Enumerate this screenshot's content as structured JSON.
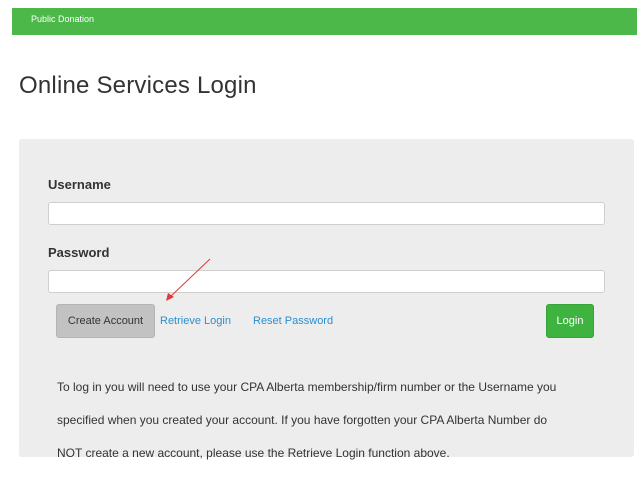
{
  "topbar": {
    "link_label": "Public Donation",
    "color": "#4cb84a"
  },
  "page": {
    "title": "Online Services Login"
  },
  "form": {
    "username_label": "Username",
    "username_value": "",
    "password_label": "Password",
    "password_value": "",
    "create_account_label": "Create Account",
    "retrieve_login_label": "Retrieve Login",
    "reset_password_label": "Reset Password",
    "login_label": "Login"
  },
  "help_text": {
    "lines": [
      "To log in you will need to use your CPA Alberta membership/firm number or the Username you",
      "specified when you created your account. If you have forgotten your CPA Alberta Number do",
      "NOT create a new account, please use the Retrieve Login function above."
    ]
  },
  "colors": {
    "login_button": "#3fb33f",
    "link": "#2a8fd1",
    "panel_background": "#ededed",
    "annotation_arrow": "#e03a3a"
  },
  "annotation": {
    "icon": "red-arrow-icon"
  }
}
